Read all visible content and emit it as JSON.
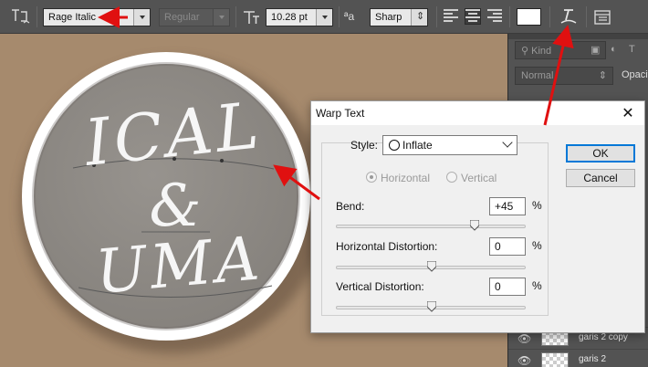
{
  "options_bar": {
    "tool_icon": "vertical-text-orientation-icon",
    "font_family": "Rage Italic",
    "font_style": "Regular",
    "font_size_icon": "font-size-icon",
    "font_size": "10.28 pt",
    "antialias_icon": "antialias-icon",
    "antialias_glyph": "ªa",
    "antialias": "Sharp",
    "align_icons": [
      "align-left-icon",
      "align-center-icon",
      "align-right-icon"
    ],
    "text_color": "#ffffff",
    "warp_icon": "warp-text-icon",
    "panels_icon": "character-panel-icon"
  },
  "canvas": {
    "background": "#a68a6d",
    "badge_fill": "#8e8a85",
    "badge_ring": "#ffffff",
    "line1": "ICAL",
    "line2": "&",
    "line3": "UMA"
  },
  "layers_panel": {
    "filter_label": "Kind",
    "blend_mode": "Normal",
    "opacity_label": "Opacity",
    "layers": [
      {
        "name": "garis 2 copy"
      },
      {
        "name": "garis 2"
      }
    ]
  },
  "dialog": {
    "title": "Warp Text",
    "style_label": "Style:",
    "style_value": "Inflate",
    "orientation": [
      "Horizontal",
      "Vertical"
    ],
    "orientation_selected": "Horizontal",
    "bend_label": "Bend:",
    "bend_value": "+45",
    "bend": 45,
    "hdist_label": "Horizontal Distortion:",
    "hdist_value": "0",
    "hdist": 0,
    "vdist_label": "Vertical Distortion:",
    "vdist_value": "0",
    "vdist": 0,
    "percent": "%",
    "ok": "OK",
    "cancel": "Cancel"
  },
  "annotations": {
    "arrow_color": "#e01010"
  }
}
